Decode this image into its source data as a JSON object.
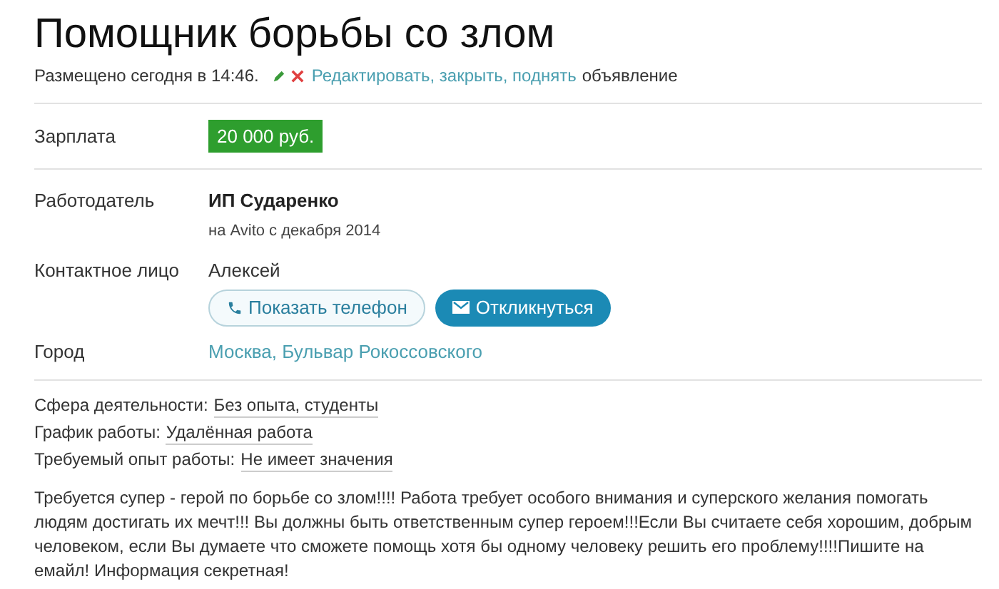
{
  "title": "Помощник борьбы со злом",
  "meta": {
    "posted": "Размещено сегодня в 14:46.",
    "actions": "Редактировать, закрыть, поднять",
    "suffix": "объявление"
  },
  "salary": {
    "label": "Зарплата",
    "value": "20 000 руб."
  },
  "employer": {
    "label": "Работодатель",
    "name": "ИП Сударенко",
    "since": "на Avito с декабря 2014"
  },
  "contact": {
    "label": "Контактное лицо",
    "name": "Алексей",
    "buttons": [
      {
        "kind": "phone",
        "label": "Показать телефон"
      },
      {
        "kind": "reply",
        "label": "Откликнуться"
      }
    ]
  },
  "city": {
    "label": "Город",
    "value": "Москва, Бульвар Рокоссовского"
  },
  "attributes": [
    {
      "label": "Сфера деятельности:",
      "value": "Без опыта, студенты"
    },
    {
      "label": "График работы:",
      "value": "Удалённая работа"
    },
    {
      "label": "Требуемый опыт работы:",
      "value": "Не имеет значения"
    }
  ],
  "description": "Требуется супер - герой по борьбе со злом!!!! Работа требует особого внимания и суперского желания помогать людям достигать их мечт!!! Вы должны быть ответственным супер героем!!!Если Вы считаете себя хорошим, добрым человеком, если Вы думаете что сможете помощь хотя бы одному человеку решить его проблему!!!!Пишите на емайл! Информация секретная!"
}
